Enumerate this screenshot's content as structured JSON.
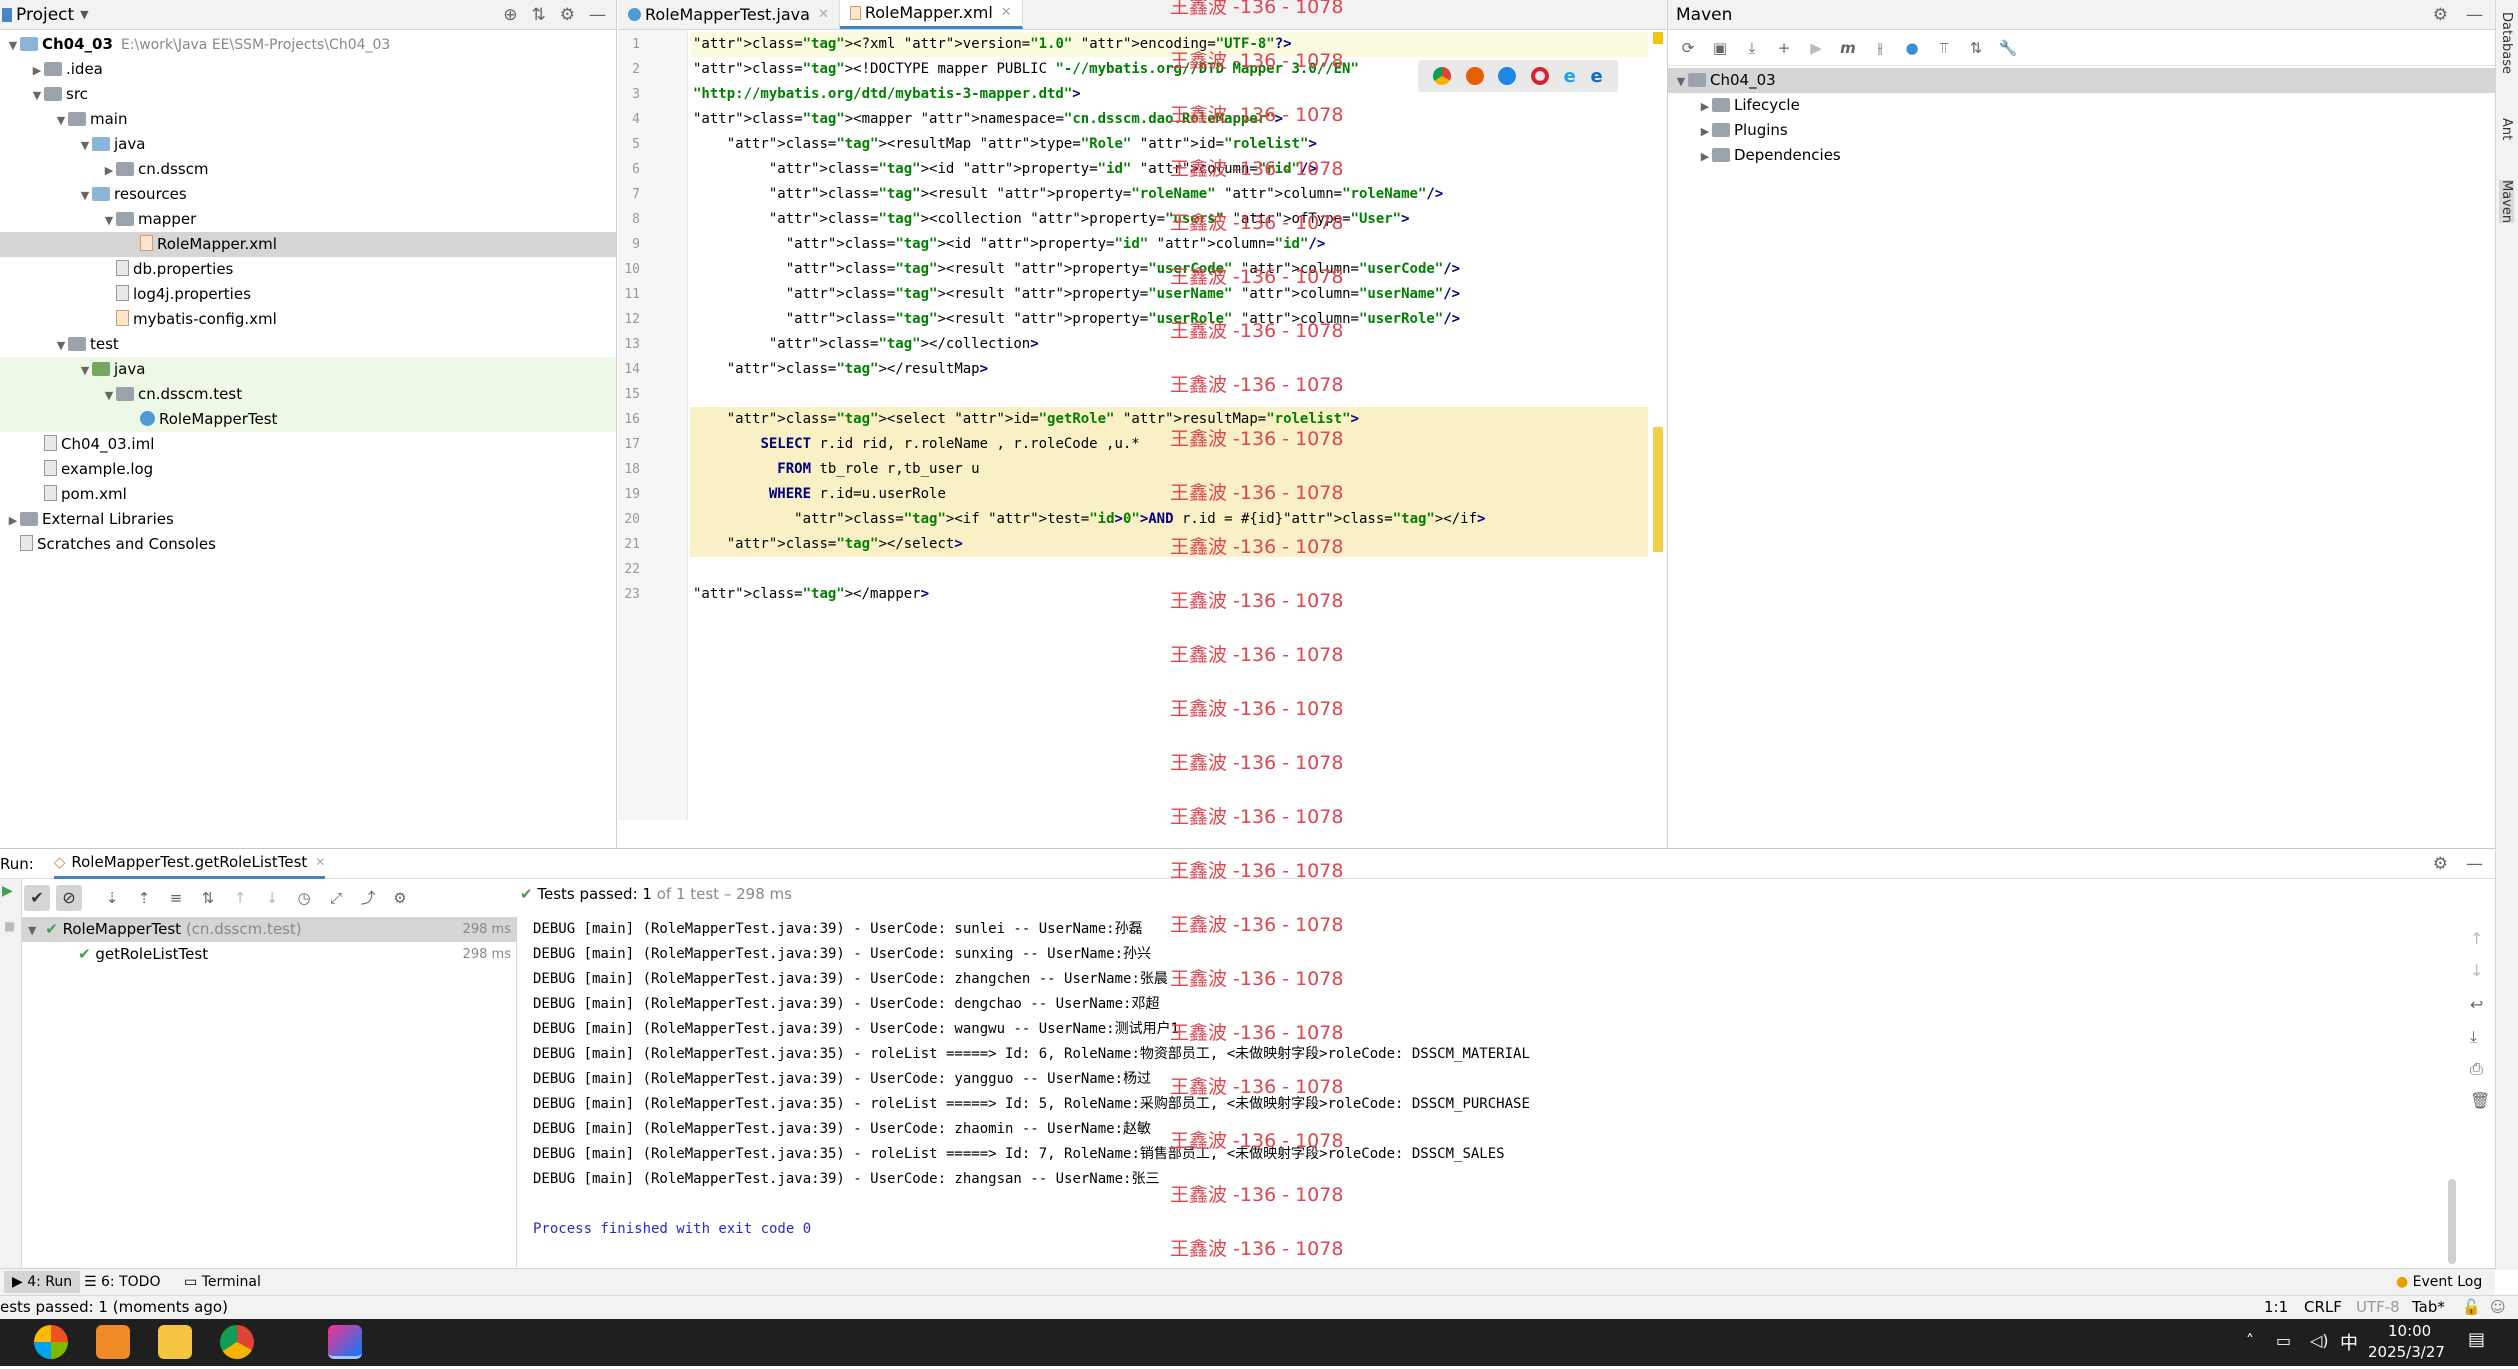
{
  "project_panel": {
    "title": "Project",
    "tree": [
      {
        "label": "Ch04_03",
        "extra": "E:\\work\\Java EE\\SSM-Projects\\Ch04_03",
        "depth": 0,
        "arrow": "▼",
        "icon": "folder"
      },
      {
        "label": ".idea",
        "depth": 1,
        "arrow": "▶",
        "icon": "folder-grey"
      },
      {
        "label": "src",
        "depth": 1,
        "arrow": "▼",
        "icon": "folder-grey"
      },
      {
        "label": "main",
        "depth": 2,
        "arrow": "▼",
        "icon": "folder-grey"
      },
      {
        "label": "java",
        "depth": 3,
        "arrow": "▼",
        "icon": "folder"
      },
      {
        "label": "cn.dsscm",
        "depth": 4,
        "arrow": "▶",
        "icon": "folder-grey"
      },
      {
        "label": "resources",
        "depth": 3,
        "arrow": "▼",
        "icon": "folder"
      },
      {
        "label": "mapper",
        "depth": 4,
        "arrow": "▼",
        "icon": "folder-grey"
      },
      {
        "label": "RoleMapper.xml",
        "depth": 5,
        "arrow": "",
        "icon": "xml"
      },
      {
        "label": "db.properties",
        "depth": 4,
        "arrow": "",
        "icon": "file"
      },
      {
        "label": "log4j.properties",
        "depth": 4,
        "arrow": "",
        "icon": "file"
      },
      {
        "label": "mybatis-config.xml",
        "depth": 4,
        "arrow": "",
        "icon": "xml"
      },
      {
        "label": "test",
        "depth": 2,
        "arrow": "▼",
        "icon": "folder-grey"
      },
      {
        "label": "java",
        "depth": 3,
        "arrow": "▼",
        "icon": "folder-green"
      },
      {
        "label": "cn.dsscm.test",
        "depth": 4,
        "arrow": "▼",
        "icon": "folder-grey"
      },
      {
        "label": "RoleMapperTest",
        "depth": 5,
        "arrow": "",
        "icon": "class"
      },
      {
        "label": "Ch04_03.iml",
        "depth": 1,
        "arrow": "",
        "icon": "file"
      },
      {
        "label": "example.log",
        "depth": 1,
        "arrow": "",
        "icon": "file"
      },
      {
        "label": "pom.xml",
        "depth": 1,
        "arrow": "",
        "icon": "file"
      },
      {
        "label": "External Libraries",
        "depth": 0,
        "arrow": "▶",
        "icon": "folder-grey"
      },
      {
        "label": "Scratches and Consoles",
        "depth": 0,
        "arrow": "",
        "icon": "file"
      }
    ]
  },
  "editor": {
    "tabs": [
      {
        "label": "RoleMapperTest.java"
      },
      {
        "label": "RoleMapper.xml"
      }
    ],
    "line_numbers": [
      "1",
      "2",
      "3",
      "4",
      "5",
      "6",
      "7",
      "8",
      "9",
      "10",
      "11",
      "12",
      "13",
      "14",
      "15",
      "16",
      "17",
      "18",
      "19",
      "20",
      "21",
      "22",
      "23"
    ],
    "lines": [
      "<?xml version=\"1.0\" encoding=\"UTF-8\"?>",
      "<!DOCTYPE mapper PUBLIC \"-//mybatis.org//DTD Mapper 3.0//EN\"",
      "\"http://mybatis.org/dtd/mybatis-3-mapper.dtd\">",
      "<mapper namespace=\"cn.dsscm.dao.RoleMapper\">",
      "    <resultMap type=\"Role\" id=\"rolelist\">",
      "         <id property=\"id\" column=\"rid\"/>",
      "         <result property=\"roleName\" column=\"roleName\"/>",
      "         <collection property=\"users\" ofType=\"User\">",
      "           <id property=\"id\" column=\"id\"/>",
      "           <result property=\"userCode\" column=\"userCode\"/>",
      "           <result property=\"userName\" column=\"userName\"/>",
      "           <result property=\"userRole\" column=\"userRole\"/>",
      "         </collection>",
      "    </resultMap>",
      "",
      "    <select id=\"getRole\" resultMap=\"rolelist\">",
      "        SELECT r.id rid, r.roleName , r.roleCode ,u.*",
      "          FROM tb_role r,tb_user u",
      "         WHERE r.id=u.userRole",
      "            <if test=\"id>0\">AND r.id = #{id}</if>",
      "    </select>",
      "",
      "</mapper>"
    ]
  },
  "maven": {
    "title": "Maven",
    "tree": [
      {
        "label": "Ch04_03",
        "arrow": "▼"
      },
      {
        "label": "Lifecycle",
        "arrow": "▶"
      },
      {
        "label": "Plugins",
        "arrow": "▶"
      },
      {
        "label": "Dependencies",
        "arrow": "▶"
      }
    ]
  },
  "sidebar_right": [
    "Database",
    "Ant",
    "Maven"
  ],
  "run_panel": {
    "label": "Run:",
    "tab": "RoleMapperTest.getRoleListTest",
    "status_prefix": "Tests passed: ",
    "status_count": "1",
    "status_suffix": " of 1 test – 298 ms",
    "tests": [
      {
        "name": "RoleMapperTest",
        "pkg": "(cn.dsscm.test)",
        "time": "298 ms"
      },
      {
        "name": "getRoleListTest",
        "pkg": "",
        "time": "298 ms"
      }
    ],
    "console": [
      "DEBUG [main] (RoleMapperTest.java:39) - UserCode: sunlei -- UserName:孙磊",
      "DEBUG [main] (RoleMapperTest.java:39) - UserCode: sunxing -- UserName:孙兴",
      "DEBUG [main] (RoleMapperTest.java:39) - UserCode: zhangchen -- UserName:张晨",
      "DEBUG [main] (RoleMapperTest.java:39) - UserCode: dengchao -- UserName:邓超",
      "DEBUG [main] (RoleMapperTest.java:39) - UserCode: wangwu -- UserName:测试用户1",
      "DEBUG [main] (RoleMapperTest.java:35) - roleList =====> Id: 6, RoleName:物资部员工, <未做映射字段>roleCode: DSSCM_MATERIAL",
      "DEBUG [main] (RoleMapperTest.java:39) - UserCode: yangguo -- UserName:杨过",
      "DEBUG [main] (RoleMapperTest.java:35) - roleList =====> Id: 5, RoleName:采购部员工, <未做映射字段>roleCode: DSSCM_PURCHASE",
      "DEBUG [main] (RoleMapperTest.java:39) - UserCode: zhaomin -- UserName:赵敏",
      "DEBUG [main] (RoleMapperTest.java:35) - roleList =====> Id: 7, RoleName:销售部员工, <未做映射字段>roleCode: DSSCM_SALES",
      "DEBUG [main] (RoleMapperTest.java:39) - UserCode: zhangsan -- UserName:张三",
      "",
      "Process finished with exit code 0"
    ]
  },
  "watermark": "王鑫波 -136 - 1078",
  "bottom_tabs": [
    "4: Run",
    "6: TODO",
    "Terminal"
  ],
  "event_log": "Event Log",
  "status_bar": {
    "left": "ests passed: 1 (moments ago)",
    "position": "1:1",
    "line_sep": "CRLF",
    "encoding": "UTF-8",
    "indent": "Tab*"
  },
  "taskbar": {
    "time": "10:00",
    "date": "2025/3/27",
    "ime": "中"
  },
  "colors": {
    "accent": "#4083c9",
    "pass_green": "#499c54",
    "watermark": "#e0454d",
    "highlight": "#f9f0c6"
  }
}
